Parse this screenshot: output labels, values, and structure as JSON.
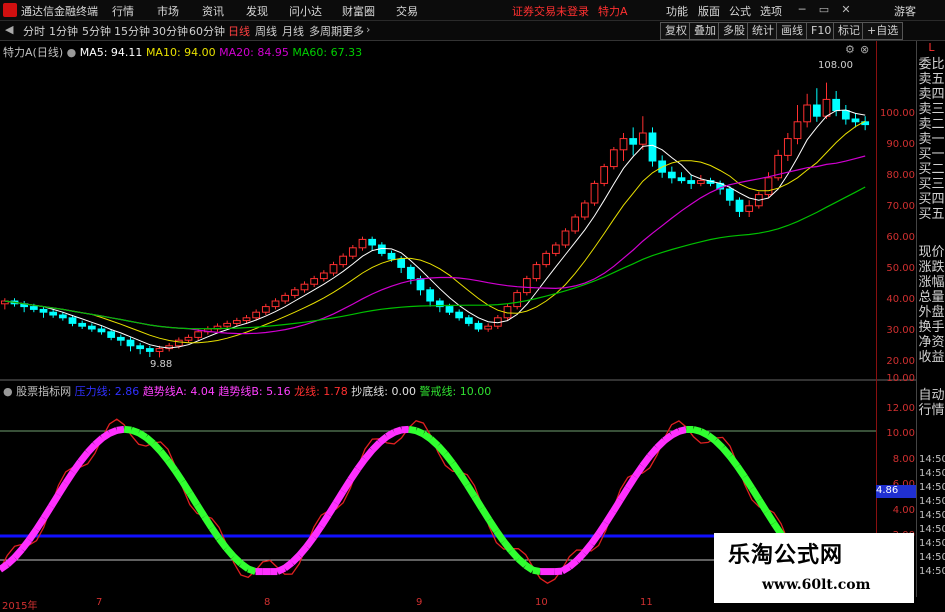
{
  "titlebar": {
    "app_title": "通达信金融终端",
    "menus": [
      "行情",
      "市场",
      "资讯",
      "发现",
      "问小达",
      "财富圈",
      "交易"
    ],
    "trade_status": "证券交易未登录",
    "stock": "特力A",
    "right_menus": [
      "功能",
      "版面",
      "公式",
      "选项"
    ],
    "guest": "游客"
  },
  "toolbar": {
    "periods": [
      "分时",
      "1分钟",
      "5分钟",
      "15分钟",
      "30分钟",
      "60分钟",
      "日线",
      "周线",
      "月线",
      "多周期",
      "更多"
    ],
    "active": "日线",
    "right_buttons": [
      "复权",
      "叠加",
      "多股",
      "统计",
      "画线",
      "F10",
      "标记",
      "+自选"
    ]
  },
  "main_legend": {
    "name": "特力A(日线)",
    "ma5": "MA5: 94.11",
    "ma10": "MA10: 94.00",
    "ma20": "MA20: 84.95",
    "ma60": "MA60: 67.33"
  },
  "ind_legend": {
    "name": "股票指标网",
    "items": [
      "压力线: 2.86",
      "趋势线A: 4.04",
      "趋势线B: 5.16",
      "龙线: 1.78",
      "抄底线: 0.00",
      "警戒线: 10.00"
    ]
  },
  "price_axis": [
    "100.00",
    "90.00",
    "80.00",
    "70.00",
    "60.00",
    "50.00",
    "40.00",
    "30.00",
    "20.00",
    "10.00"
  ],
  "ind_axis": [
    "12.00",
    "10.00",
    "8.00",
    "6.00",
    "4.00",
    "2.00"
  ],
  "ind_axis_right": [
    "14:50",
    "14:50",
    "14:50",
    "14:50",
    "14:50",
    "14:50",
    "14:50",
    "14:50",
    "14:50"
  ],
  "current_ind_value": "4.86",
  "annotations": {
    "high": "108.00",
    "low": "9.88"
  },
  "x_labels": [
    "2015年",
    "7",
    "8",
    "9",
    "10",
    "11"
  ],
  "right_panel": [
    "L",
    "委比",
    "卖五",
    "卖四",
    "卖三",
    "卖二",
    "卖一",
    "买一",
    "买二",
    "买三",
    "买四",
    "买五",
    "现价",
    "涨跌",
    "涨幅",
    "总量",
    "外盘",
    "换手",
    "净资",
    "收益",
    "自动",
    "行情"
  ],
  "watermark": {
    "title": "乐淘公式网",
    "url": "www.60lt.com"
  },
  "colors": {
    "ma5": "#ffffff",
    "ma10": "#ffff00",
    "ma20": "#ff00ff",
    "ma60": "#00ff00",
    "up": "#ff3030",
    "down": "#00ffff"
  },
  "chart_data": {
    "type": "candlestick",
    "ylim": [
      5,
      115
    ],
    "candles": [
      [
        29,
        30,
        27,
        31
      ],
      [
        30,
        29,
        28,
        31
      ],
      [
        29,
        28,
        26,
        30
      ],
      [
        28,
        27,
        26,
        29
      ],
      [
        27,
        26,
        24,
        28
      ],
      [
        26,
        25,
        24,
        27
      ],
      [
        25,
        24,
        23,
        26
      ],
      [
        24,
        22,
        21,
        25
      ],
      [
        22,
        21,
        20,
        23
      ],
      [
        21,
        20,
        19,
        22
      ],
      [
        20,
        19,
        18,
        21
      ],
      [
        19,
        17,
        16,
        20
      ],
      [
        17,
        16,
        14,
        18
      ],
      [
        16,
        14,
        12,
        17
      ],
      [
        14,
        13,
        11,
        15
      ],
      [
        13,
        12,
        10,
        14
      ],
      [
        12,
        13,
        9.88,
        14
      ],
      [
        13,
        14,
        12,
        15
      ],
      [
        14,
        16,
        13,
        17
      ],
      [
        16,
        17,
        15,
        18
      ],
      [
        17,
        19,
        16,
        20
      ],
      [
        19,
        20,
        18,
        21
      ],
      [
        20,
        21,
        19,
        22
      ],
      [
        21,
        22,
        20,
        23
      ],
      [
        22,
        23,
        21,
        24
      ],
      [
        23,
        24,
        22,
        25
      ],
      [
        24,
        26,
        23,
        27
      ],
      [
        26,
        28,
        25,
        29
      ],
      [
        28,
        30,
        27,
        31
      ],
      [
        30,
        32,
        29,
        33
      ],
      [
        32,
        34,
        31,
        35
      ],
      [
        34,
        36,
        33,
        37
      ],
      [
        36,
        38,
        35,
        39
      ],
      [
        38,
        40,
        37,
        41
      ],
      [
        40,
        43,
        39,
        44
      ],
      [
        43,
        46,
        42,
        47
      ],
      [
        46,
        49,
        45,
        50
      ],
      [
        49,
        52,
        48,
        53
      ],
      [
        52,
        50,
        48,
        53
      ],
      [
        50,
        47,
        46,
        51
      ],
      [
        47,
        45,
        44,
        48
      ],
      [
        45,
        42,
        40,
        46
      ],
      [
        42,
        38,
        36,
        43
      ],
      [
        38,
        34,
        32,
        39
      ],
      [
        34,
        30,
        28,
        35
      ],
      [
        30,
        28,
        26,
        31
      ],
      [
        28,
        26,
        25,
        29
      ],
      [
        26,
        24,
        23,
        27
      ],
      [
        24,
        22,
        21,
        25
      ],
      [
        22,
        20,
        19,
        23
      ],
      [
        20,
        21,
        19,
        22
      ],
      [
        21,
        24,
        20,
        25
      ],
      [
        24,
        28,
        23,
        29
      ],
      [
        28,
        33,
        27,
        34
      ],
      [
        33,
        38,
        32,
        39
      ],
      [
        38,
        43,
        37,
        44
      ],
      [
        43,
        47,
        42,
        48
      ],
      [
        47,
        50,
        46,
        51
      ],
      [
        50,
        55,
        49,
        56
      ],
      [
        55,
        60,
        54,
        61
      ],
      [
        60,
        65,
        59,
        66
      ],
      [
        65,
        72,
        64,
        73
      ],
      [
        72,
        78,
        71,
        79
      ],
      [
        78,
        84,
        77,
        85
      ],
      [
        84,
        88,
        80,
        90
      ],
      [
        88,
        86,
        82,
        92
      ],
      [
        86,
        90,
        84,
        96
      ],
      [
        90,
        80,
        78,
        92
      ],
      [
        80,
        76,
        74,
        82
      ],
      [
        76,
        74,
        72,
        78
      ],
      [
        74,
        73,
        72,
        76
      ],
      [
        73,
        72,
        70,
        75
      ],
      [
        72,
        73,
        71,
        75
      ],
      [
        73,
        72,
        71,
        74
      ],
      [
        72,
        70,
        68,
        73
      ],
      [
        70,
        66,
        64,
        71
      ],
      [
        66,
        62,
        60,
        67
      ],
      [
        62,
        64,
        60,
        66
      ],
      [
        64,
        68,
        63,
        69
      ],
      [
        68,
        74,
        67,
        76
      ],
      [
        74,
        82,
        73,
        84
      ],
      [
        82,
        88,
        80,
        90
      ],
      [
        88,
        94,
        86,
        100
      ],
      [
        94,
        100,
        92,
        104
      ],
      [
        100,
        96,
        94,
        106
      ],
      [
        96,
        102,
        95,
        108
      ],
      [
        102,
        98,
        96,
        105
      ],
      [
        98,
        95,
        93,
        100
      ],
      [
        95,
        94,
        92,
        97
      ],
      [
        94,
        93,
        91,
        96
      ]
    ]
  }
}
